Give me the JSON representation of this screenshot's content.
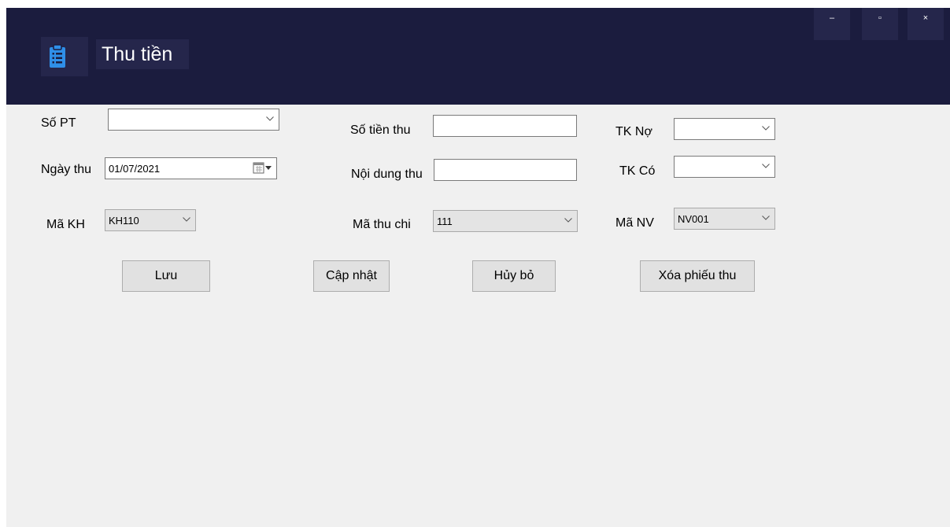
{
  "window": {
    "title": "Thu tiền",
    "controls": {
      "minimize": "–",
      "maximize": "▫",
      "close": "×"
    }
  },
  "form": {
    "so_pt": {
      "label": "Số PT",
      "value": ""
    },
    "ngay_thu": {
      "label": "Ngày thu",
      "value": "01/07/2021"
    },
    "ma_kh": {
      "label": "Mã KH",
      "value": "KH110"
    },
    "so_tien_thu": {
      "label": "Số tiền thu",
      "value": ""
    },
    "noi_dung_thu": {
      "label": "Nội dung thu",
      "value": ""
    },
    "ma_thu_chi": {
      "label": "Mã thu chi",
      "value": "111"
    },
    "tk_no": {
      "label": "TK Nợ",
      "value": ""
    },
    "tk_co": {
      "label": "TK Có",
      "value": ""
    },
    "ma_nv": {
      "label": "Mã NV",
      "value": "NV001"
    }
  },
  "buttons": {
    "luu": "Lưu",
    "cap_nhat": "Cập nhật",
    "huy_bo": "Hủy bỏ",
    "xoa_phieu_thu": "Xóa phiếu thu"
  },
  "icons": {
    "app": "clipboard-list-icon",
    "dropdown": "chevron-down-icon",
    "calendar": "calendar-icon"
  },
  "colors": {
    "titlebar": "#1b1c3e",
    "app_icon": "#2f8fe8",
    "window_bg": "#f0f0f0"
  }
}
